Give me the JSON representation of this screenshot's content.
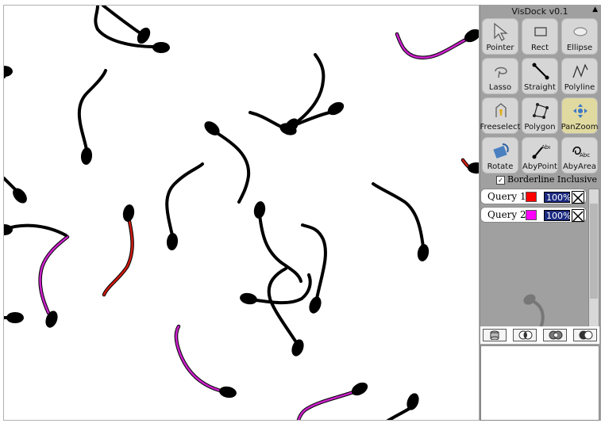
{
  "app": {
    "title": "VisDock v0.1"
  },
  "tools": [
    {
      "id": "pointer",
      "label": "Pointer",
      "active": false,
      "icon": "pointer-arrow-icon"
    },
    {
      "id": "rect",
      "label": "Rect",
      "active": false,
      "icon": "rectangle-icon"
    },
    {
      "id": "ellipse",
      "label": "Ellipse",
      "active": false,
      "icon": "ellipse-icon"
    },
    {
      "id": "lasso",
      "label": "Lasso",
      "active": false,
      "icon": "lasso-icon"
    },
    {
      "id": "straight",
      "label": "Straight",
      "active": false,
      "icon": "straight-line-icon"
    },
    {
      "id": "polyline",
      "label": "Polyline",
      "active": false,
      "icon": "polyline-icon"
    },
    {
      "id": "freeselect",
      "label": "Freeselect",
      "active": false,
      "icon": "freeselect-pen-icon"
    },
    {
      "id": "polygon",
      "label": "Polygon",
      "active": false,
      "icon": "polygon-icon"
    },
    {
      "id": "panzoom",
      "label": "PanZoom",
      "active": true,
      "icon": "pan-zoom-icon"
    },
    {
      "id": "rotate",
      "label": "Rotate",
      "active": false,
      "icon": "rotate-icon"
    },
    {
      "id": "abypoint",
      "label": "AbyPoint",
      "active": false,
      "icon": "annotate-by-point-icon"
    },
    {
      "id": "abyarea",
      "label": "AbyArea",
      "active": false,
      "icon": "annotate-by-area-icon"
    }
  ],
  "options": {
    "borderline_label": "Borderline Inclusive",
    "borderline_checked": true,
    "check_glyph": "✓"
  },
  "queries": [
    {
      "name": "Query 1",
      "color": "#ff0000",
      "opacity": "100%"
    },
    {
      "name": "Query 2",
      "color": "#ff00ff",
      "opacity": "100%"
    }
  ],
  "boolean_ops": [
    {
      "id": "common",
      "icon": "cylinder-stack-icon"
    },
    {
      "id": "and",
      "icon": "intersection-icon"
    },
    {
      "id": "or",
      "icon": "union-icon"
    },
    {
      "id": "xor",
      "icon": "difference-icon"
    }
  ],
  "colors": {
    "black": "#000000",
    "query1": "#cc1a10",
    "query2": "#cc22cc"
  }
}
